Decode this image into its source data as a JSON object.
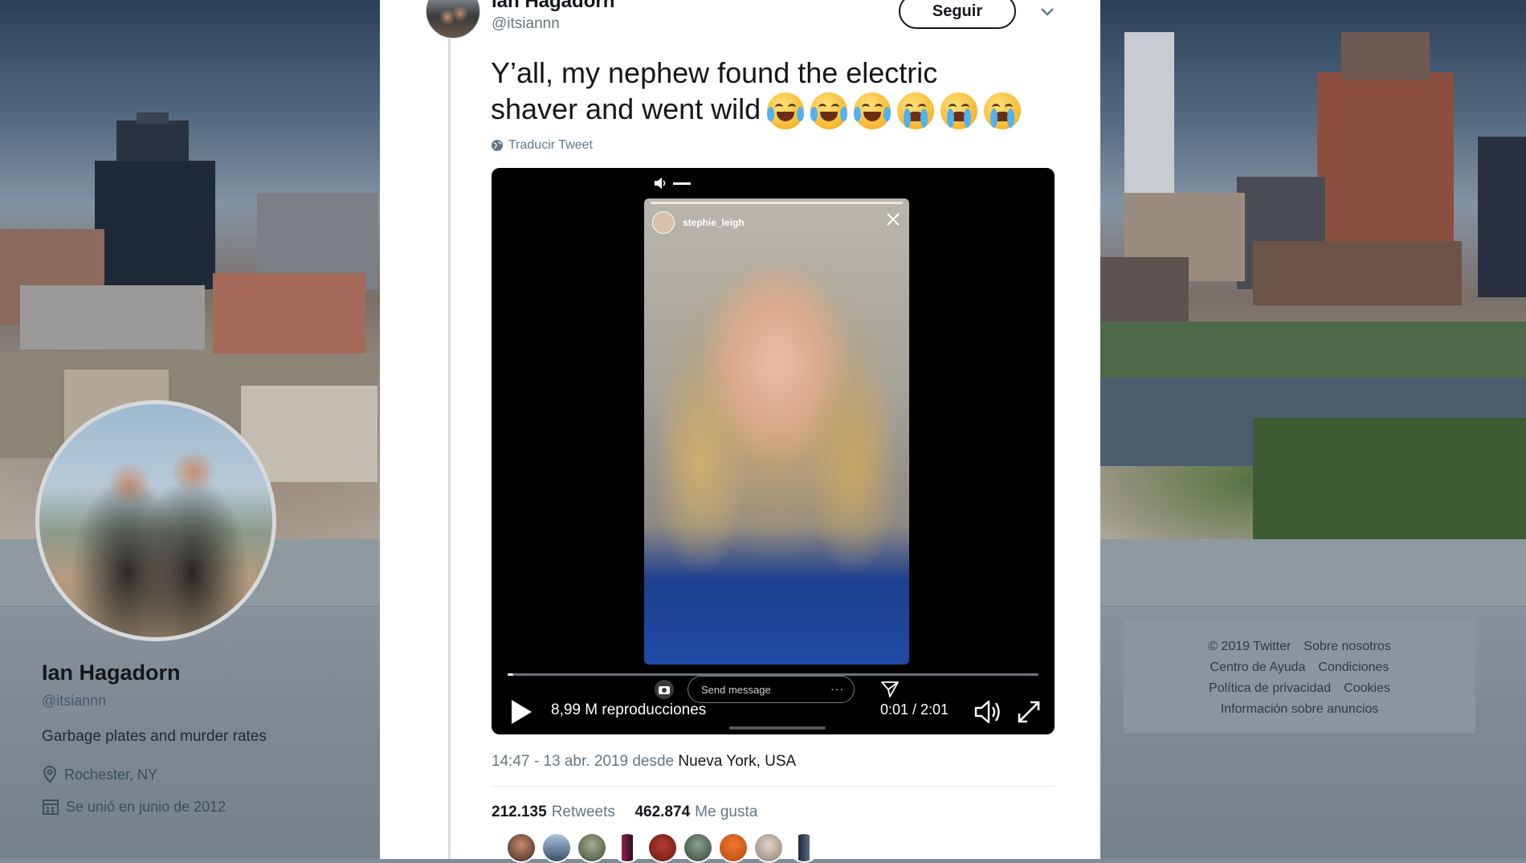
{
  "profile": {
    "name": "Ian Hagadorn",
    "handle": "@itsiannn",
    "bio": "Garbage plates and murder rates",
    "location": "Rochester, NY",
    "joined": "Se unió en junio de 2012"
  },
  "footer": {
    "links": [
      [
        "© 2019 Twitter",
        "Sobre nosotros"
      ],
      [
        "Centro de Ayuda",
        "Condiciones"
      ],
      [
        "Política de privacidad",
        "Cookies"
      ],
      [
        "Información sobre anuncios"
      ]
    ]
  },
  "tweet": {
    "author_name": "Ian Hagadorn",
    "author_handle": "@itsiannn",
    "follow_label": "Seguir",
    "text_line1": "Y’all, my nephew found the electric",
    "text_line2": "shaver and went wild",
    "emojis": [
      "face-with-tears-of-joy",
      "face-with-tears-of-joy",
      "face-with-tears-of-joy",
      "loudly-crying-face",
      "loudly-crying-face",
      "loudly-crying-face"
    ],
    "translate_label": "Traducir Tweet",
    "timestamp": "14:47 - 13 abr. 2019 desde",
    "place": "Nueva York, USA",
    "retweets_count": "212.135",
    "retweets_label": "Retweets",
    "likes_count": "462.874",
    "likes_label": "Me gusta"
  },
  "video": {
    "story_username": "stephie_leigh",
    "send_message_placeholder": "Send message",
    "views": "8,99 M reproducciones",
    "time": "0:01 / 2:01",
    "progress": 0.01
  },
  "colors": {
    "accent": "#1da1f2",
    "text_primary": "#14171a",
    "text_secondary": "#657786"
  }
}
